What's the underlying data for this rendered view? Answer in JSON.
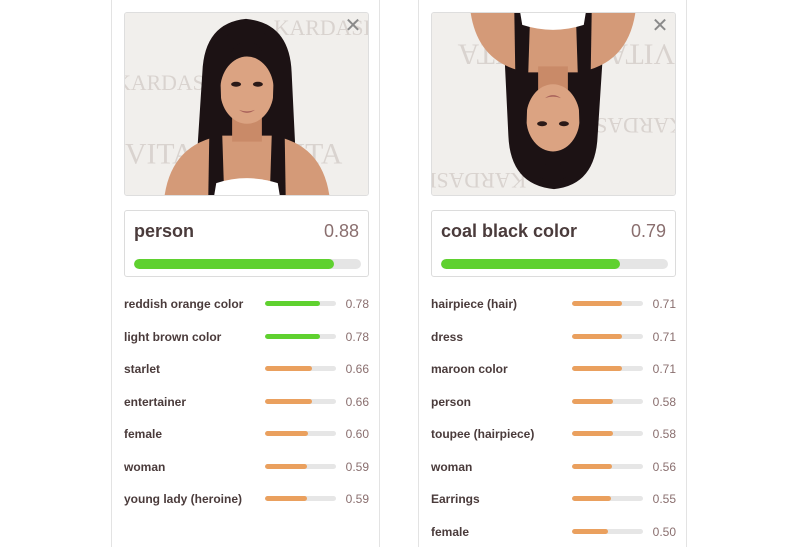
{
  "colors": {
    "high": "#5fd12f",
    "mid": "#eaa05e",
    "track": "#e5e5e5"
  },
  "cards": [
    {
      "close_icon": "close-icon",
      "photo_text": [
        "KARDASHIAN",
        "VITA"
      ],
      "top": {
        "label": "person",
        "score": "0.88",
        "fraction": 0.88,
        "color": "#5fd12f"
      },
      "items": [
        {
          "label": "reddish orange color",
          "score": "0.78",
          "fraction": 0.78,
          "color": "#5fd12f"
        },
        {
          "label": "light brown color",
          "score": "0.78",
          "fraction": 0.78,
          "color": "#5fd12f"
        },
        {
          "label": "starlet",
          "score": "0.66",
          "fraction": 0.66,
          "color": "#eaa05e"
        },
        {
          "label": "entertainer",
          "score": "0.66",
          "fraction": 0.66,
          "color": "#eaa05e"
        },
        {
          "label": "female",
          "score": "0.60",
          "fraction": 0.6,
          "color": "#eaa05e"
        },
        {
          "label": "woman",
          "score": "0.59",
          "fraction": 0.59,
          "color": "#eaa05e"
        },
        {
          "label": "young lady (heroine)",
          "score": "0.59",
          "fraction": 0.59,
          "color": "#eaa05e"
        }
      ]
    },
    {
      "close_icon": "close-icon",
      "photo_text": [
        "KARDASHIAN",
        "VITA"
      ],
      "top": {
        "label": "coal black color",
        "score": "0.79",
        "fraction": 0.79,
        "color": "#5fd12f"
      },
      "items": [
        {
          "label": "hairpiece (hair)",
          "score": "0.71",
          "fraction": 0.71,
          "color": "#eaa05e"
        },
        {
          "label": "dress",
          "score": "0.71",
          "fraction": 0.71,
          "color": "#eaa05e"
        },
        {
          "label": "maroon color",
          "score": "0.71",
          "fraction": 0.71,
          "color": "#eaa05e"
        },
        {
          "label": "person",
          "score": "0.58",
          "fraction": 0.58,
          "color": "#eaa05e"
        },
        {
          "label": "toupee (hairpiece)",
          "score": "0.58",
          "fraction": 0.58,
          "color": "#eaa05e"
        },
        {
          "label": "woman",
          "score": "0.56",
          "fraction": 0.56,
          "color": "#eaa05e"
        },
        {
          "label": "Earrings",
          "score": "0.55",
          "fraction": 0.55,
          "color": "#eaa05e"
        },
        {
          "label": "female",
          "score": "0.50",
          "fraction": 0.5,
          "color": "#eaa05e"
        }
      ]
    }
  ]
}
